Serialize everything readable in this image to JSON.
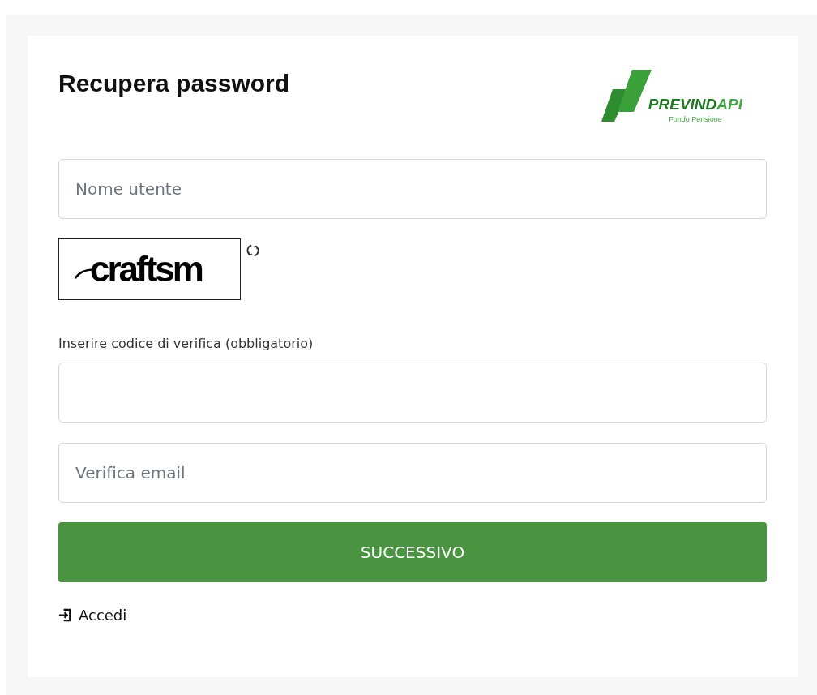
{
  "title": "Recupera password",
  "logo": {
    "brand_main": "PREVIND",
    "brand_accent": "API",
    "tagline": "Fondo Pensione"
  },
  "username": {
    "placeholder": "Nome utente"
  },
  "captcha": {
    "text": "craftsm"
  },
  "verification": {
    "label": "Inserire codice di verifica (obbligatorio)"
  },
  "email": {
    "placeholder": "Verifica email"
  },
  "submit": "SUCCESSIVO",
  "login_link": "Accedi"
}
